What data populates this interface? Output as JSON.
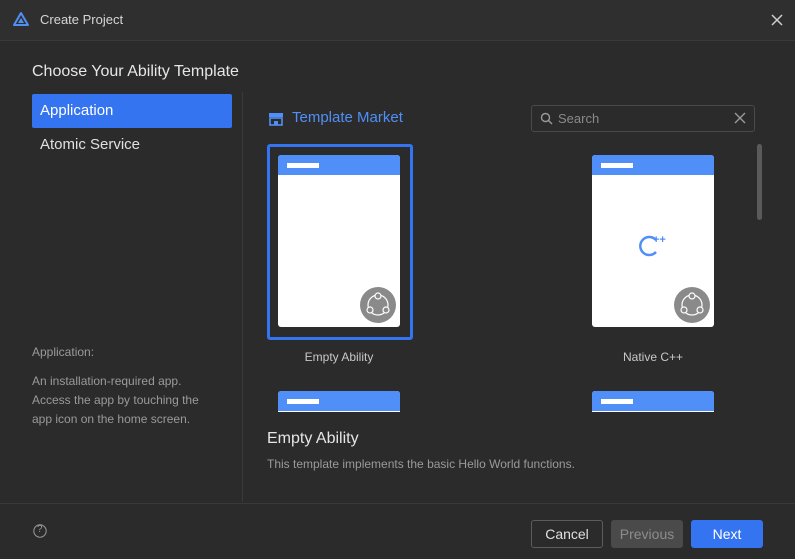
{
  "window": {
    "title": "Create Project"
  },
  "page": {
    "heading": "Choose Your Ability Template"
  },
  "sidebar": {
    "items": [
      {
        "label": "Application",
        "active": true
      },
      {
        "label": "Atomic Service",
        "active": false
      }
    ]
  },
  "category_description": {
    "title": "Application:",
    "body": "An installation-required app. Access the app by touching the app icon on the home screen."
  },
  "market": {
    "label": "Template Market",
    "icon": "storefront-icon"
  },
  "search": {
    "placeholder": "Search",
    "value": ""
  },
  "templates": [
    {
      "name": "Empty Ability",
      "selected": true
    },
    {
      "name": "Native C++",
      "selected": false,
      "icon_text": "++"
    },
    {
      "name": "",
      "selected": false
    },
    {
      "name": "",
      "selected": false
    }
  ],
  "selected_template": {
    "title": "Empty Ability",
    "description": "This template implements the basic Hello World functions."
  },
  "footer": {
    "cancel_label": "Cancel",
    "previous_label": "Previous",
    "next_label": "Next",
    "help_symbol": "?"
  },
  "colors": {
    "accent": "#3574f0",
    "link": "#4f8ff7",
    "background": "#2b2b2b",
    "card": "#ffffff"
  }
}
